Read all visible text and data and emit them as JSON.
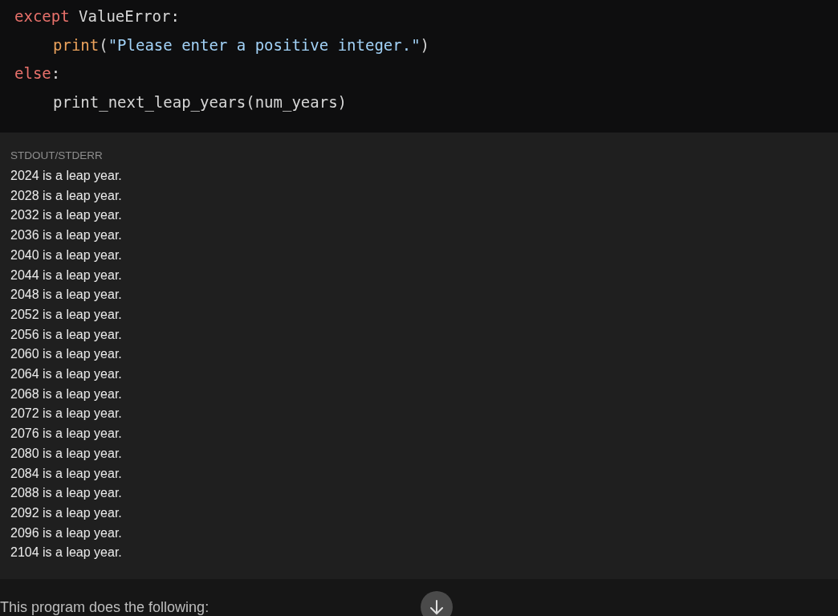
{
  "code_block": {
    "lines": [
      {
        "indented": false,
        "tokens": [
          {
            "kind": "keyword",
            "text": "except"
          },
          {
            "kind": "plain",
            "text": " ValueError:"
          }
        ]
      },
      {
        "indented": true,
        "tokens": [
          {
            "kind": "builtin",
            "text": "print"
          },
          {
            "kind": "plain",
            "text": "("
          },
          {
            "kind": "string",
            "text": "\"Please enter a positive integer.\""
          },
          {
            "kind": "plain",
            "text": ")"
          }
        ]
      },
      {
        "indented": false,
        "tokens": [
          {
            "kind": "keyword",
            "text": "else"
          },
          {
            "kind": "plain",
            "text": ":"
          }
        ]
      },
      {
        "indented": true,
        "tokens": [
          {
            "kind": "plain",
            "text": "print_next_leap_years(num_years)"
          }
        ]
      }
    ]
  },
  "output": {
    "label": "STDOUT/STDERR",
    "lines": [
      "2024 is a leap year.",
      "2028 is a leap year.",
      "2032 is a leap year.",
      "2036 is a leap year.",
      "2040 is a leap year.",
      "2044 is a leap year.",
      "2048 is a leap year.",
      "2052 is a leap year.",
      "2056 is a leap year.",
      "2060 is a leap year.",
      "2064 is a leap year.",
      "2068 is a leap year.",
      "2072 is a leap year.",
      "2076 is a leap year.",
      "2080 is a leap year.",
      "2084 is a leap year.",
      "2088 is a leap year.",
      "2092 is a leap year.",
      "2096 is a leap year.",
      "2104 is a leap year."
    ]
  },
  "message": {
    "text": "This program does the following:"
  }
}
